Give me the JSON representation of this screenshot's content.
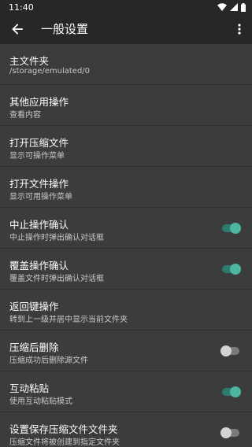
{
  "status_bar": {
    "time": "11:40"
  },
  "header": {
    "title": "一般设置"
  },
  "accent_color": "#4db6a2",
  "settings": [
    {
      "title": "主文件夹",
      "subtitle": "/storage/emulated/0"
    },
    {
      "title": "其他应用操作",
      "subtitle": "查看内容"
    },
    {
      "title": "打开压缩文件",
      "subtitle": "显示可操作菜单"
    },
    {
      "title": "打开文件操作",
      "subtitle": "显示可用操作菜单"
    },
    {
      "title": "中止操作确认",
      "subtitle": "中止操作时弹出确认对话框",
      "toggle": true
    },
    {
      "title": "覆盖操作确认",
      "subtitle": "覆盖文件时弹出确认对话框",
      "toggle": true
    },
    {
      "title": "返回键操作",
      "subtitle": "转到上一级并居中显示当前文件夹"
    },
    {
      "title": "压缩后删除",
      "subtitle": "压缩成功后删除源文件",
      "toggle": false
    },
    {
      "title": "互动粘贴",
      "subtitle": "使用互动粘贴模式",
      "toggle": true
    },
    {
      "title": "设置保存压缩文件文件夹",
      "subtitle": "压缩文件将被创建到指定文件夹",
      "toggle": false
    }
  ]
}
